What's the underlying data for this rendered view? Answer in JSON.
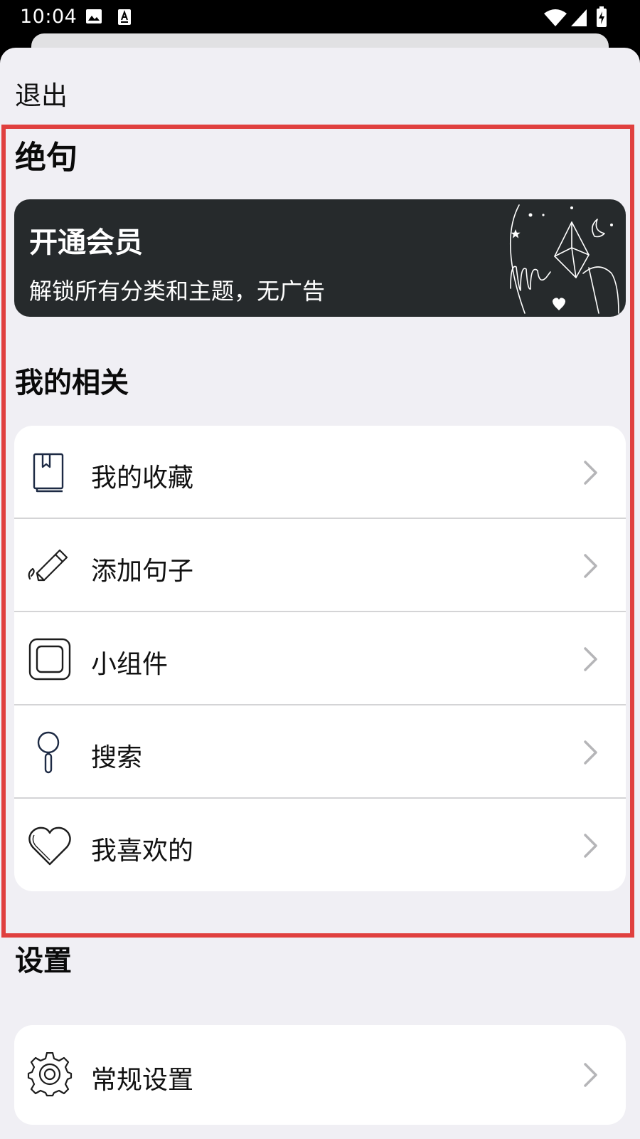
{
  "status_bar": {
    "time": "10:04"
  },
  "header": {
    "exit_label": "退出"
  },
  "app_section": {
    "title": "绝句"
  },
  "banner": {
    "title": "开通会员",
    "subtitle": "解锁所有分类和主题，无广告"
  },
  "mine": {
    "title": "我的相关",
    "items": [
      {
        "label": "我的收藏",
        "icon": "bookmark-book-icon"
      },
      {
        "label": "添加句子",
        "icon": "pencil-icon"
      },
      {
        "label": "小组件",
        "icon": "widget-square-icon"
      },
      {
        "label": "搜索",
        "icon": "magnifier-icon"
      },
      {
        "label": "我喜欢的",
        "icon": "heart-icon"
      }
    ]
  },
  "settings": {
    "title": "设置",
    "items": [
      {
        "label": "常规设置",
        "icon": "gear-icon"
      }
    ]
  },
  "colors": {
    "highlight": "#e0403f",
    "banner_bg": "#262a2c",
    "page_bg": "#f0eff4",
    "chevron": "#b5b5b8"
  }
}
